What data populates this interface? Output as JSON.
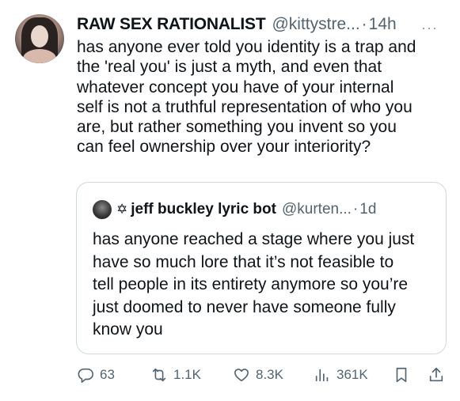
{
  "post": {
    "display_name": "RAW SEX RATIONALIST",
    "handle": "@kittystre...",
    "separator": "·",
    "time": "14h",
    "more_label": "···",
    "text": "has anyone ever told you identity is a trap and\nthe 'real you' is just a myth, and even that\nwhatever concept you have of your internal\nself is not a truthful representation of who you\nare, but rather something you invent so you\ncan feel ownership over your interiority?"
  },
  "quoted_post": {
    "badge_symbol": "✡",
    "display_name": "jeff buckley lyric bot",
    "handle": "@kurten...",
    "separator": "·",
    "time": "1d",
    "text": "has anyone reached a stage where you just\nhave so much lore that it’s not feasible to\ntell people in its entirety anymore so you’re\njust doomed to never have someone fully\nknow you"
  },
  "actions": {
    "replies": "63",
    "reposts": "1.1K",
    "likes": "8.3K",
    "views": "361K"
  },
  "icons": {
    "reply": "reply-icon",
    "repost": "repost-icon",
    "like": "heart-icon",
    "views": "views-icon",
    "bookmark": "bookmark-icon",
    "share": "share-icon"
  },
  "colors": {
    "text_primary": "#0f1419",
    "text_secondary": "#536471",
    "border": "#cfd9de"
  }
}
